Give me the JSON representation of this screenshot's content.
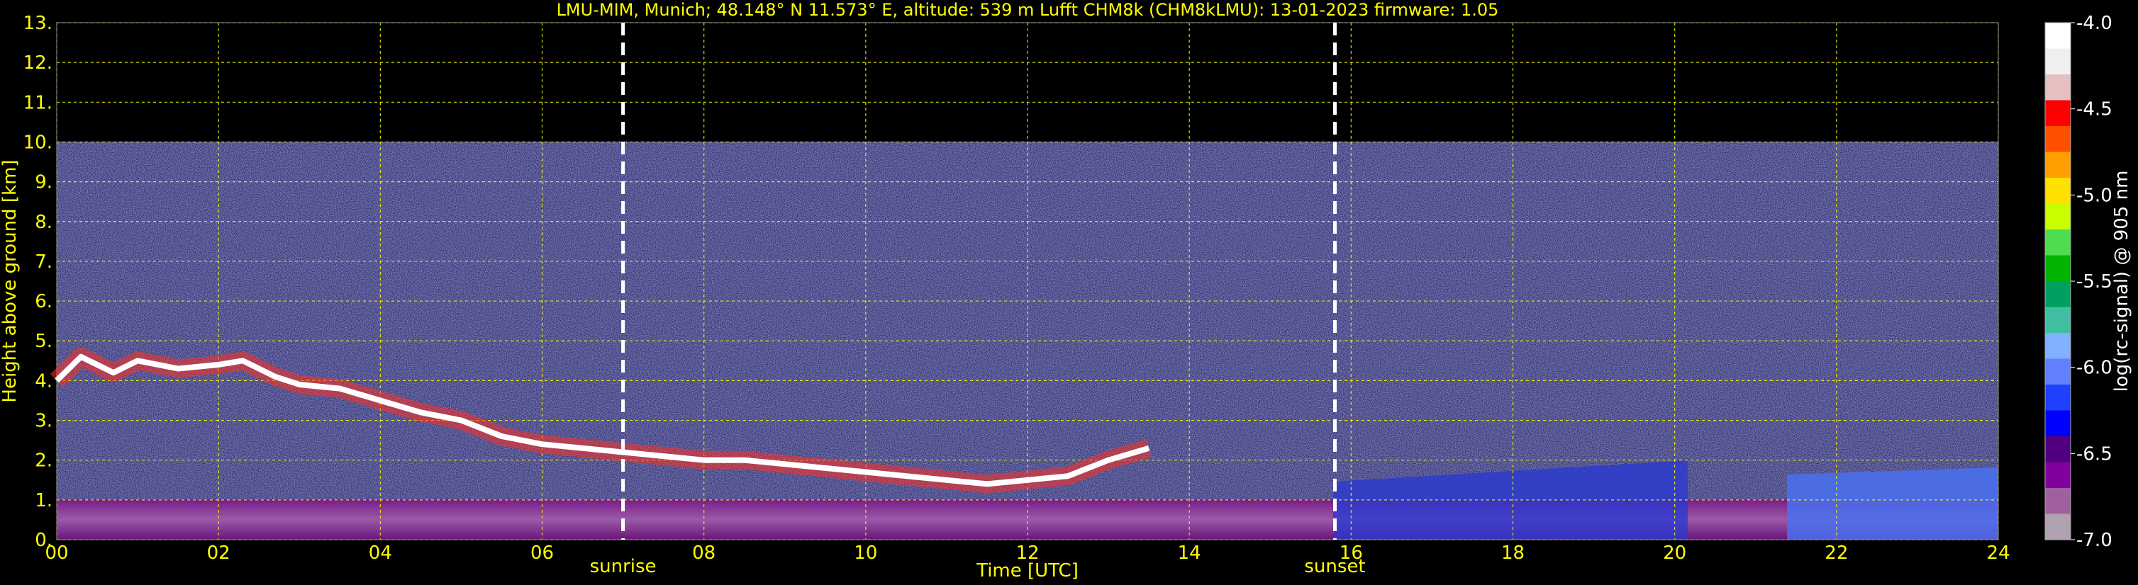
{
  "chart_data": {
    "type": "heatmap",
    "title": "LMU-MIM, Munich; 48.148° N 11.573° E, altitude: 539 m    Lufft CHM8k (CHM8kLMU): 13-01-2023    firmware: 1.05",
    "xlabel": "Time [UTC]",
    "ylabel": "Height above ground [km]",
    "xlim": [
      0,
      24
    ],
    "ylim": [
      0,
      13
    ],
    "x_ticks": [
      "00",
      "02",
      "04",
      "06",
      "08",
      "10",
      "12",
      "14",
      "16",
      "18",
      "20",
      "22",
      "24"
    ],
    "y_ticks": [
      "0.",
      "1.",
      "2.",
      "3.",
      "4.",
      "5.",
      "6.",
      "7.",
      "8.",
      "9.",
      "10.",
      "11.",
      "12.",
      "13."
    ],
    "grid": true,
    "measurement_top_km": 10,
    "markers": [
      {
        "label": "sunrise",
        "time_utc": 7.0
      },
      {
        "label": "sunset",
        "time_utc": 15.8
      }
    ],
    "colorbar": {
      "label": "log(rc-signal) @ 905 nm",
      "min": -7.0,
      "max": -4.0,
      "ticks": [
        "-4.0",
        "-4.5",
        "-5.0",
        "-5.5",
        "-6.0",
        "-6.5",
        "-7.0"
      ],
      "colors": [
        "#ffffff",
        "#f0f0f0",
        "#e6c0c0",
        "#ff0000",
        "#ff5000",
        "#ffa000",
        "#ffe000",
        "#c8ff00",
        "#50dc50",
        "#00b400",
        "#00a060",
        "#40c0a0",
        "#80b0ff",
        "#6080ff",
        "#2040ff",
        "#0000ff",
        "#500080",
        "#8000a0",
        "#a060a0",
        "#b0a0b0"
      ]
    },
    "series": [
      {
        "name": "",
        "description_points_time_utc": [
          0.0,
          0.3,
          0.7,
          1.0,
          1.5,
          2.0,
          2.3,
          2.7,
          3.0,
          3.5,
          4.0,
          4.5,
          5.0,
          5.5,
          6.0,
          6.5,
          7.0,
          7.5,
          8.0,
          8.5,
          9.0,
          9.5,
          10.0,
          10.5,
          11.0,
          11.5,
          12.0,
          12.5,
          13.0,
          13.5
        ],
        "height_km": [
          4.0,
          4.6,
          4.2,
          4.5,
          4.3,
          4.4,
          4.5,
          4.1,
          3.9,
          3.8,
          3.5,
          3.2,
          3.0,
          2.6,
          2.4,
          2.3,
          2.2,
          2.1,
          2.0,
          2.0,
          1.9,
          1.8,
          1.7,
          1.6,
          1.5,
          1.4,
          1.5,
          1.6,
          2.0,
          2.3
        ]
      }
    ]
  }
}
